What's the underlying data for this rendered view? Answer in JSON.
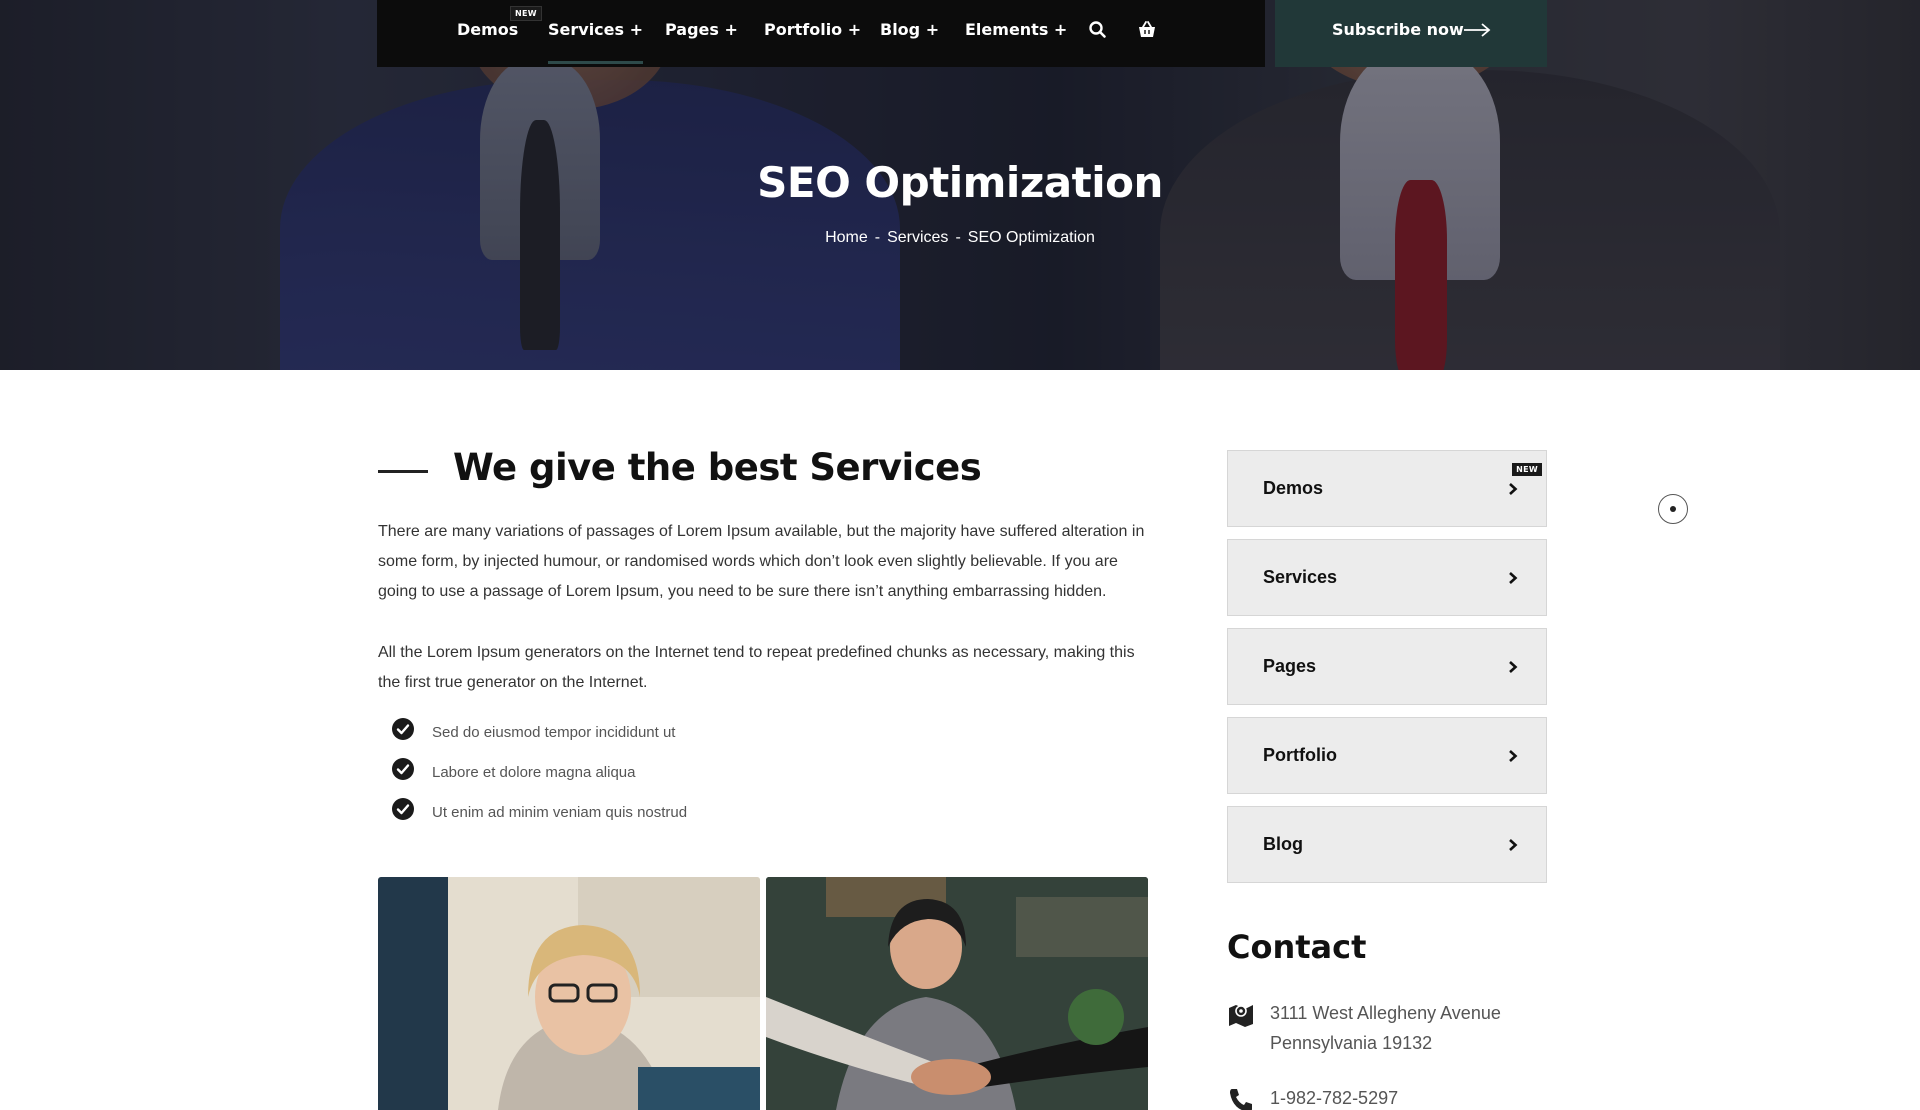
{
  "nav": {
    "items": [
      {
        "label": "Demos"
      },
      {
        "label": "Services +"
      },
      {
        "label": "Pages +"
      },
      {
        "label": "Portfolio +"
      },
      {
        "label": "Blog +"
      },
      {
        "label": "Elements +"
      }
    ],
    "new_badge": "NEW",
    "search_icon": "search-icon",
    "cart_icon": "basket-icon",
    "subscribe_label": "Subscribe now"
  },
  "hero": {
    "title": "SEO Optimization",
    "breadcrumb": [
      "Home",
      "Services",
      "SEO Optimization"
    ],
    "separator": "-"
  },
  "main": {
    "heading": "We give the best Services",
    "paragraphs": [
      "There are many variations of passages of Lorem Ipsum available, but the majority have suffered alteration in some form, by injected humour, or randomised words which don’t look even slightly believable. If you are going to use a passage of Lorem Ipsum, you need to be sure there isn’t anything embarrassing hidden.",
      "All the Lorem Ipsum generators on the Internet tend to repeat predefined chunks as necessary, making this the first true generator on the Internet."
    ],
    "checklist": [
      "Sed do eiusmod tempor incididunt ut",
      "Labore et dolore magna aliqua",
      "Ut enim ad minim veniam quis nostrud"
    ]
  },
  "sidebar": {
    "items": [
      {
        "label": "Demos",
        "badge": "NEW"
      },
      {
        "label": "Services"
      },
      {
        "label": "Pages"
      },
      {
        "label": "Portfolio"
      },
      {
        "label": "Blog"
      }
    ]
  },
  "contact": {
    "title": "Contact",
    "address_line1": "3111 West Allegheny Avenue",
    "address_line2": "Pennsylvania 19132",
    "phone": "1-982-782-5297"
  },
  "colors": {
    "nav_bg": "#0c0c0c",
    "subscribe_bg": "#213838",
    "sidebar_item_bg": "#ececec",
    "text_dark": "#111111"
  }
}
